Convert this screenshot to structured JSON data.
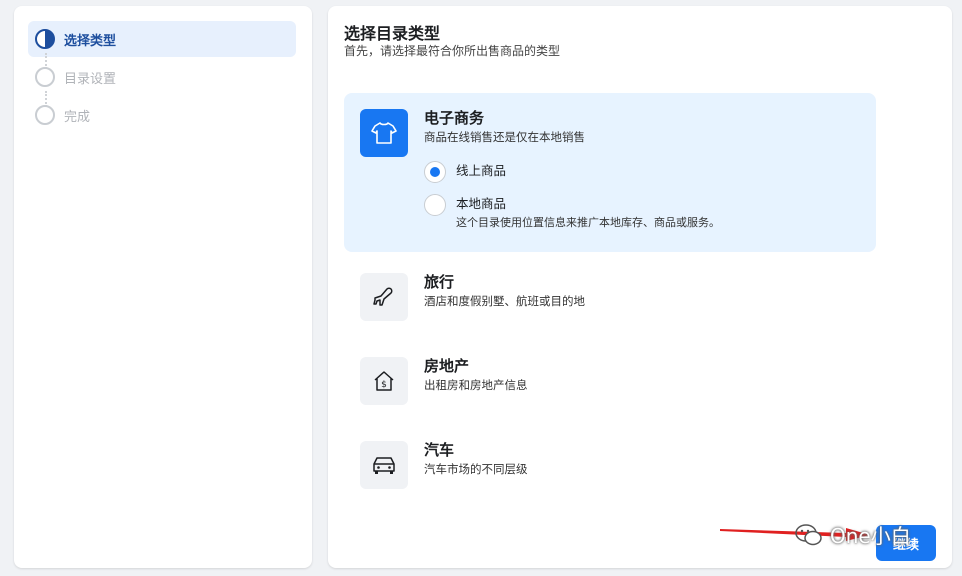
{
  "steps": [
    {
      "label": "选择类型",
      "state": "active"
    },
    {
      "label": "目录设置",
      "state": "inactive"
    },
    {
      "label": "完成",
      "state": "inactive"
    }
  ],
  "header": {
    "title": "选择目录类型",
    "subtitle": "首先，请选择最符合你所出售商品的类型"
  },
  "options": [
    {
      "title": "电子商务",
      "desc": "商品在线销售还是仅在本地销售",
      "icon": "tshirt-icon",
      "selected": true,
      "radios": [
        {
          "label": "线上商品",
          "checked": true,
          "sub": ""
        },
        {
          "label": "本地商品",
          "checked": false,
          "sub": "这个目录使用位置信息来推广本地库存、商品或服务。"
        }
      ]
    },
    {
      "title": "旅行",
      "desc": "酒店和度假别墅、航班或目的地",
      "icon": "airplane-icon"
    },
    {
      "title": "房地产",
      "desc": "出租房和房地产信息",
      "icon": "house-dollar-icon"
    },
    {
      "title": "汽车",
      "desc": "汽车市场的不同层级",
      "icon": "car-icon"
    }
  ],
  "footer": {
    "continue_label": "继续",
    "watermark": "One小白"
  },
  "colors": {
    "accent": "#1877f2",
    "active_step_text": "#1d4e9e",
    "selected_bg": "#e7f3ff",
    "annotation_arrow": "#e02020"
  }
}
